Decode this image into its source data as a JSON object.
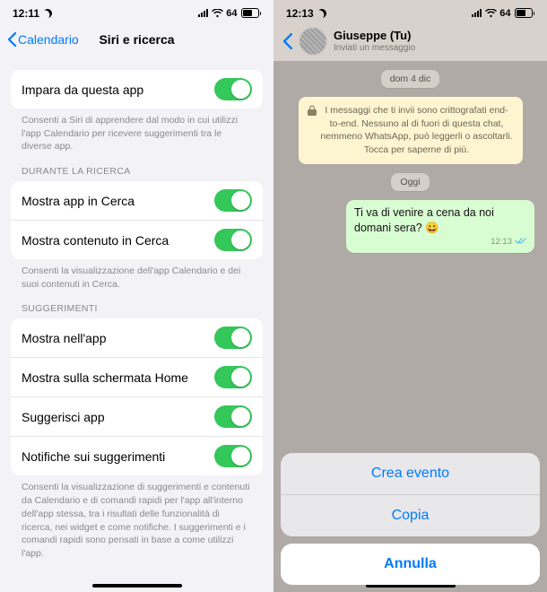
{
  "left": {
    "status": {
      "time": "12:11",
      "battery": "64"
    },
    "back_label": "Calendario",
    "title": "Siri e ricerca",
    "learn": {
      "label": "Impara da questa app",
      "footer": "Consenti a Siri di apprendere dal modo in cui utilizzi l'app Calendario per ricevere suggerimenti tra le diverse app."
    },
    "search": {
      "header": "DURANTE LA RICERCA",
      "items": [
        "Mostra app in Cerca",
        "Mostra contenuto in Cerca"
      ],
      "footer": "Consenti la visualizzazione dell'app Calendario e dei suoi contenuti in Cerca."
    },
    "suggest": {
      "header": "SUGGERIMENTI",
      "items": [
        "Mostra nell'app",
        "Mostra sulla schermata Home",
        "Suggerisci app",
        "Notifiche sui suggerimenti"
      ],
      "footer": "Consenti la visualizzazione di suggerimenti e contenuti da Calendario e di comandi rapidi per l'app all'interno dell'app stessa, tra i risultati delle funzionalità di ricerca, nei widget e come notifiche. I suggerimenti e i comandi rapidi sono pensati in base a come utilizzi l'app."
    }
  },
  "right": {
    "status": {
      "time": "12:13",
      "battery": "64"
    },
    "contact": {
      "name": "Giuseppe (Tu)",
      "subtitle": "Inviati un messaggio"
    },
    "date_pill": "dom 4 dic",
    "encryption": "I messaggi che ti invii sono crittografati end-to-end. Nessuno al di fuori di questa chat, nemmeno WhatsApp, può leggerli o ascoltarli. Tocca per saperne di più.",
    "today_pill": "Oggi",
    "message": {
      "text": "Ti va di venire a cena da noi domani sera? 😀",
      "time": "12:13"
    },
    "sheet": {
      "actions": [
        "Crea evento",
        "Copia"
      ],
      "cancel": "Annulla"
    }
  }
}
